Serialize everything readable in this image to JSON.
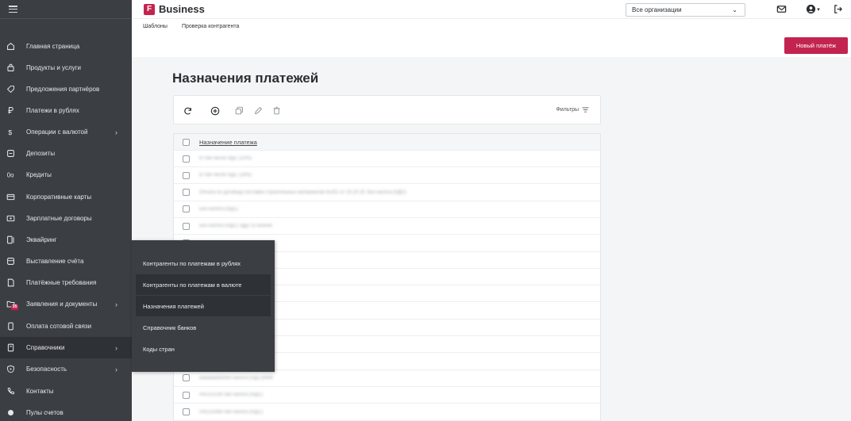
{
  "app": {
    "brand_letter": "F",
    "brand_name": "Business",
    "accent_color": "#c3244f"
  },
  "header": {
    "org_select_value": "Все организации",
    "tabs": [
      "Шаблоны",
      "Проверка контрагента"
    ],
    "new_payment_label": "Новый платёж",
    "icons": [
      "mail-icon",
      "user-icon",
      "chevron-down-icon",
      "logout-icon"
    ]
  },
  "sidebar": {
    "items": [
      {
        "label": "Главная страница",
        "icon": "home-icon",
        "chevron": ""
      },
      {
        "label": "Продукты и услуги",
        "icon": "bag-icon",
        "chevron": ""
      },
      {
        "label": "Предложения партнёров",
        "icon": "tag-icon",
        "chevron": ""
      },
      {
        "label": "Платежи в рублях",
        "icon": "ruble-icon",
        "chevron": ""
      },
      {
        "label": "Операции с валютой",
        "icon": "dollar-icon",
        "chevron": "›"
      },
      {
        "label": "Депозиты",
        "icon": "deposit-icon",
        "chevron": ""
      },
      {
        "label": "Кредиты",
        "icon": "credit-icon",
        "chevron": ""
      },
      {
        "label": "Корпоративные карты",
        "icon": "card-icon",
        "chevron": ""
      },
      {
        "label": "Зарплатные договоры",
        "icon": "salary-icon",
        "chevron": ""
      },
      {
        "label": "Эквайринг",
        "icon": "terminal-icon",
        "chevron": ""
      },
      {
        "label": "Выставление счёта",
        "icon": "invoice-icon",
        "chevron": ""
      },
      {
        "label": "Платёжные требования",
        "icon": "document-icon",
        "chevron": ""
      },
      {
        "label": "Заявления и документы",
        "icon": "folder-icon",
        "chevron": "›",
        "badge": "35"
      },
      {
        "label": "Оплата сотовой связи",
        "icon": "phone-icon",
        "chevron": ""
      },
      {
        "label": "Справочники",
        "icon": "book-icon",
        "chevron": "›",
        "active": true
      },
      {
        "label": "Безопасность",
        "icon": "shield-icon",
        "chevron": "›"
      },
      {
        "label": "Контакты",
        "icon": "contact-phone-icon",
        "chevron": ""
      },
      {
        "label": "Пулы счетов",
        "icon": "circle-icon",
        "chevron": ""
      }
    ]
  },
  "submenu": {
    "items": [
      "Контрагенты по платежам в рублях",
      "Контрагенты по платежам в валюте",
      "Назначения платежей",
      "Справочник банков",
      "Коды стран"
    ]
  },
  "main": {
    "title": "Назначения платежей",
    "toolbar_icons": [
      "refresh-icon",
      "add-icon",
      "copy-icon",
      "edit-icon",
      "delete-icon"
    ],
    "filters_label": "Фильтры",
    "table": {
      "header": "Назначение платежа",
      "rows": [
        "В том числе НДС (10%)",
        "В том числе НДС (18%)",
        "Оплата по договору поставки строительных материалов №151 от 15.10.19. Без налога (НДС)",
        "Без налога (НДС)",
        "Без налога (НДС) тдру ту ононон",
        "",
        "",
        "",
        "",
        "",
        "",
        "",
        "",
        "аааааааббббб налога (НДС)9999",
        "041515185 без налога (НДС)",
        "041515485 без налога (НДС)"
      ]
    }
  }
}
